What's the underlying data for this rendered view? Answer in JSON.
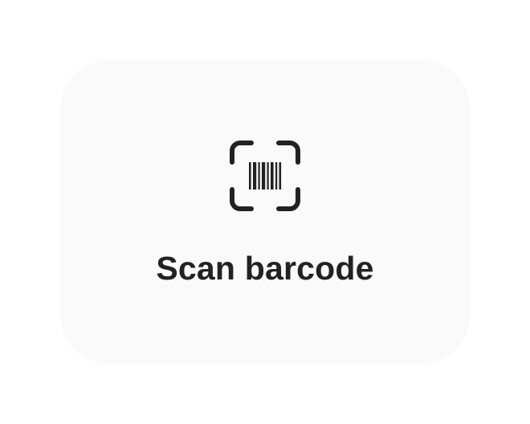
{
  "action": {
    "label": "Scan barcode",
    "icon": "barcode-scan-icon"
  },
  "colors": {
    "card_background": "#fafafa",
    "text": "#222222",
    "icon": "#222222"
  }
}
